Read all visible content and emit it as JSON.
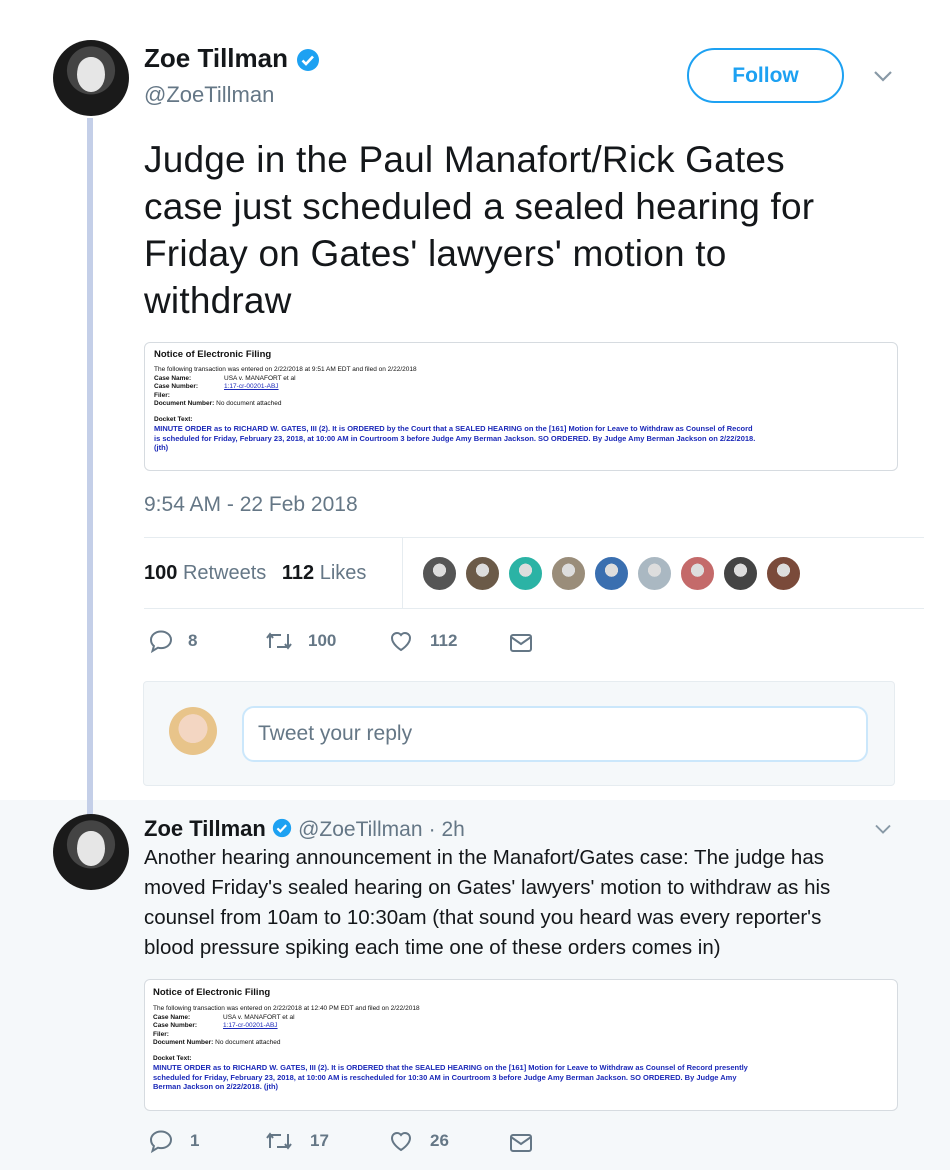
{
  "main_tweet": {
    "author_name": "Zoe Tillman",
    "handle": "@ZoeTillman",
    "follow_label": "Follow",
    "text": "Judge in the Paul Manafort/Rick Gates case just scheduled a sealed hearing for Friday on Gates' lawyers' motion to withdraw",
    "lines": [
      "Judge in the Paul Manafort/Rick Gates",
      "case just scheduled a sealed hearing for",
      "Friday on Gates' lawyers' motion to",
      "withdraw"
    ],
    "timestamp": "9:54 AM - 22 Feb 2018",
    "retweets_count": "100",
    "retweets_label": "Retweets",
    "likes_count": "112",
    "likes_label": "Likes",
    "actions": {
      "replies": "8",
      "retweets": "100",
      "likes": "112"
    },
    "reply_placeholder": "Tweet your reply",
    "liker_avatar_colors": [
      "#555",
      "#6b5a48",
      "#2bb3a5",
      "#9a8d7a",
      "#3a6fb0",
      "#aab8c2",
      "#c46a6a",
      "#444",
      "#7a4a3a"
    ],
    "filing": {
      "title": "Notice of Electronic Filing",
      "transaction": "The following transaction was entered on 2/22/2018 at 9:51 AM EDT and filed on 2/22/2018",
      "case_name_label": "Case Name:",
      "case_name": "USA v. MANAFORT et al",
      "case_number_label": "Case Number:",
      "case_number": "1:17-cr-00201-ABJ",
      "filer_label": "Filer:",
      "document_number_label": "Document Number:",
      "document_number": "No document attached",
      "docket_text_label": "Docket Text:",
      "docket_lines": [
        "MINUTE ORDER as to RICHARD W. GATES, III (2). It is ORDERED by the Court that a SEALED HEARING on the [161] Motion for Leave to Withdraw as Counsel of Record",
        "is scheduled for Friday, February 23, 2018, at 10:00 AM in Courtroom 3 before Judge Amy Berman Jackson. SO ORDERED. By Judge Amy Berman Jackson on 2/22/2018.",
        "(jth)"
      ]
    }
  },
  "reply_tweet": {
    "author_name": "Zoe Tillman",
    "handle": "@ZoeTillman",
    "time": "· 2h",
    "lines": [
      "Another hearing announcement in the Manafort/Gates case: The judge has",
      "moved Friday's sealed hearing on Gates' lawyers' motion to withdraw as his",
      "counsel from 10am to 10:30am (that sound you heard was every reporter's",
      "blood pressure spiking each time one of these orders comes in)"
    ],
    "actions": {
      "replies": "1",
      "retweets": "17",
      "likes": "26"
    },
    "filing": {
      "title": "Notice of Electronic Filing",
      "transaction": "The following transaction was entered on 2/22/2018 at 12:40 PM EDT and filed on 2/22/2018",
      "case_name_label": "Case Name:",
      "case_name": "USA v. MANAFORT et al",
      "case_number_label": "Case Number:",
      "case_number": "1:17-cr-00201-ABJ",
      "filer_label": "Filer:",
      "document_number_label": "Document Number:",
      "document_number": "No document attached",
      "docket_text_label": "Docket Text:",
      "docket_lines": [
        "MINUTE ORDER as to RICHARD W. GATES, III (2). It is ORDERED that the SEALED HEARING on the [161] Motion for Leave to Withdraw as Counsel of Record presently",
        "scheduled for Friday, February 23, 2018, at 10:00 AM is rescheduled for 10:30 AM in Courtroom 3 before Judge Amy Berman Jackson. SO ORDERED. By Judge Amy",
        "Berman Jackson on 2/22/2018. (jth)"
      ]
    }
  },
  "colors": {
    "accent": "#1da1f2",
    "muted": "#657786",
    "docket_blue": "#1b29b8",
    "thread_line": "#c4cfe8"
  }
}
